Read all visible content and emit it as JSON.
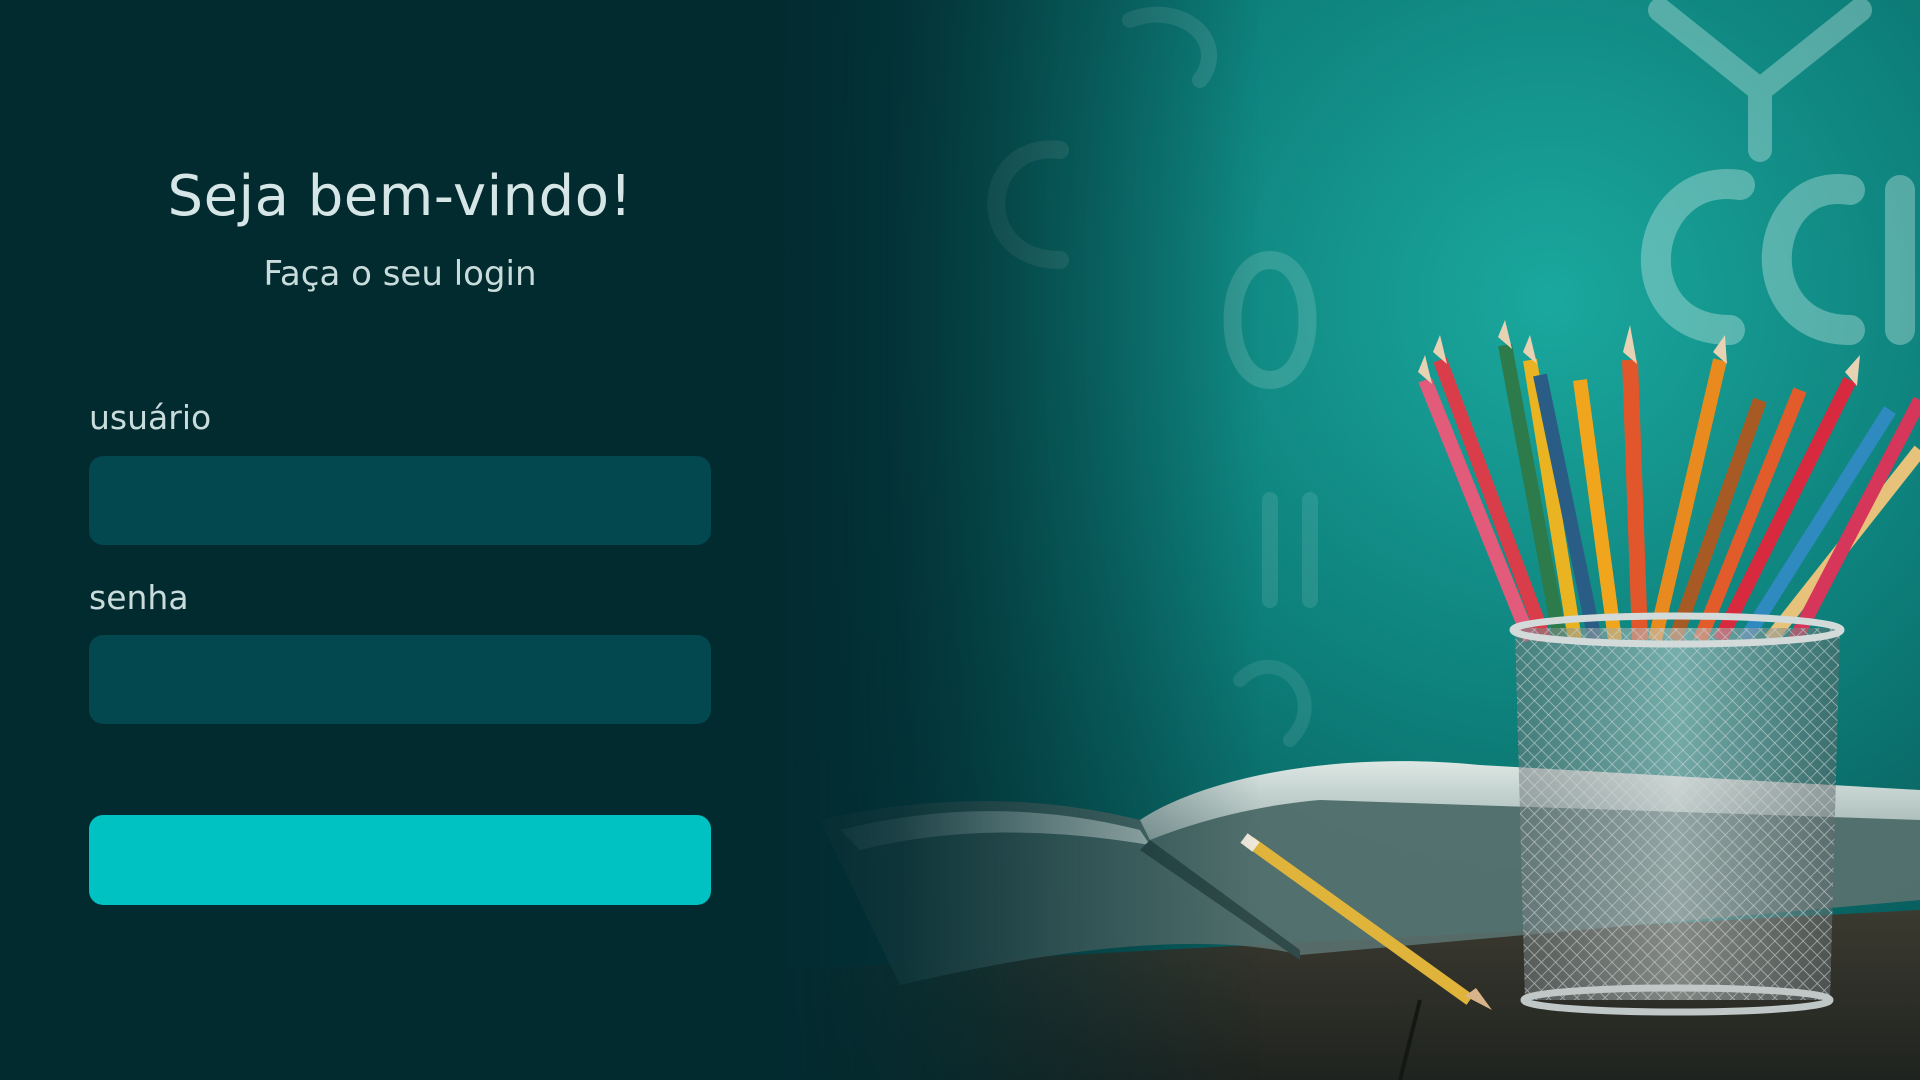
{
  "login": {
    "title": "Seja bem-vindo!",
    "subtitle": "Faça o seu login",
    "username_label": "usuário",
    "username_value": "",
    "password_label": "senha",
    "password_value": "",
    "submit_label": ""
  },
  "colors": {
    "panel_background": "#022b30",
    "input_background": "#03474f",
    "button_accent": "#00c2c2",
    "chalkboard": "#0e8f88"
  },
  "illustration": {
    "description_icon": "pencil-cup-and-open-book-on-chalkboard"
  }
}
